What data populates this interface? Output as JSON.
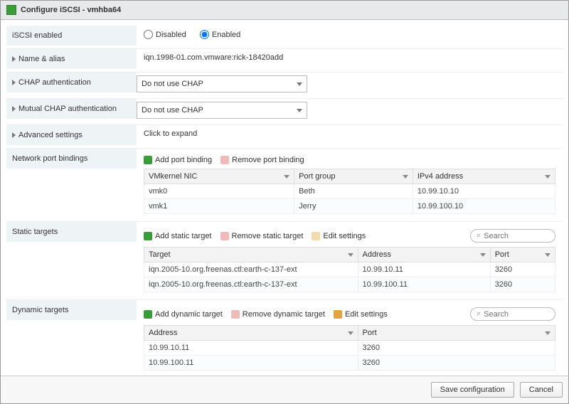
{
  "title": "Configure iSCSI - vmhba64",
  "rows": {
    "iscsi_enabled": {
      "label": "iSCSI enabled",
      "disabled": "Disabled",
      "enabled": "Enabled",
      "value": "enabled"
    },
    "name_alias": {
      "label": "Name & alias",
      "value": "iqn.1998-01.com.vmware:rick-18420add"
    },
    "chap": {
      "label": "CHAP authentication",
      "value": "Do not use CHAP"
    },
    "mutual_chap": {
      "label": "Mutual CHAP authentication",
      "value": "Do not use CHAP"
    },
    "advanced": {
      "label": "Advanced settings",
      "value": "Click to expand"
    },
    "port_bindings": {
      "label": "Network port bindings",
      "add": "Add port binding",
      "remove": "Remove port binding",
      "cols": {
        "nic": "VMkernel NIC",
        "pg": "Port group",
        "ip": "IPv4 address"
      },
      "rows": [
        {
          "nic": "vmk0",
          "pg": "Beth",
          "ip": "10.99.10.10"
        },
        {
          "nic": "vmk1",
          "pg": "Jerry",
          "ip": "10.99.100.10"
        }
      ]
    },
    "static_targets": {
      "label": "Static targets",
      "add": "Add static target",
      "remove": "Remove static target",
      "edit": "Edit settings",
      "search_ph": "Search",
      "cols": {
        "target": "Target",
        "addr": "Address",
        "port": "Port"
      },
      "rows": [
        {
          "target": "iqn.2005-10.org.freenas.ctl:earth-c-137-ext",
          "addr": "10.99.10.11",
          "port": "3260"
        },
        {
          "target": "iqn.2005-10.org.freenas.ctl:earth-c-137-ext",
          "addr": "10.99.100.11",
          "port": "3260"
        }
      ]
    },
    "dynamic_targets": {
      "label": "Dynamic targets",
      "add": "Add dynamic target",
      "remove": "Remove dynamic target",
      "edit": "Edit settings",
      "search_ph": "Search",
      "cols": {
        "addr": "Address",
        "port": "Port"
      },
      "rows": [
        {
          "addr": "10.99.10.11",
          "port": "3260"
        },
        {
          "addr": "10.99.100.11",
          "port": "3260"
        }
      ]
    }
  },
  "footer": {
    "save": "Save configuration",
    "cancel": "Cancel"
  }
}
